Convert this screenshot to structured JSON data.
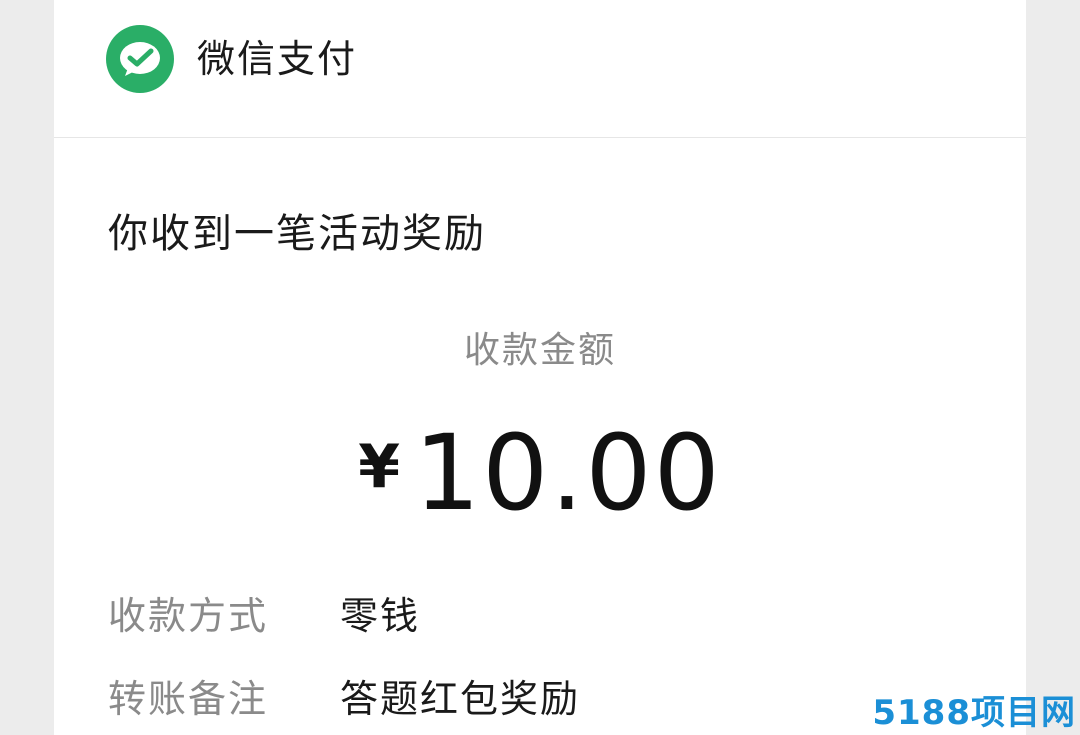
{
  "header": {
    "brand": "微信支付",
    "icon": "wechat-pay-icon",
    "accent_color": "#2aae67"
  },
  "notice": {
    "title": "你收到一笔活动奖励"
  },
  "amount": {
    "label": "收款金额",
    "currency": "¥",
    "value": "10.00"
  },
  "details": [
    {
      "label": "收款方式",
      "value": "零钱"
    },
    {
      "label": "转账备注",
      "value": "答题红包奖励"
    }
  ],
  "watermark": {
    "text": "5188项目网",
    "color": "#1b8fd6"
  }
}
